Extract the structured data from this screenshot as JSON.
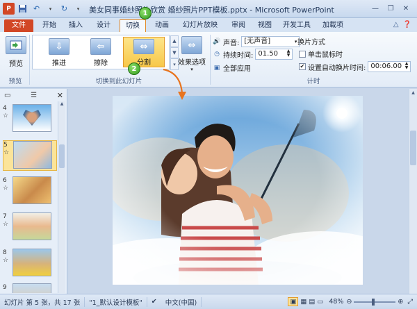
{
  "title": "美女同事婚纱照片欣赏 婚纱照片PPT模板.pptx - Microsoft PowerPoint",
  "tabs": {
    "file": "文件",
    "home": "开始",
    "insert": "插入",
    "design": "设计",
    "transitions": "切换",
    "animations": "动画",
    "slideshow": "幻灯片放映",
    "review": "审阅",
    "view": "视图",
    "developer": "开发工具",
    "addins": "加载项"
  },
  "ribbon": {
    "preview_label": "预览",
    "preview_group": "预览",
    "transitions": [
      {
        "label": "推进"
      },
      {
        "label": "擦除"
      },
      {
        "label": "分割"
      }
    ],
    "effect_options_label": "效果选项",
    "transitions_group": "切换到此幻灯片",
    "sound_label": "声音:",
    "sound_value": "[无声音]",
    "duration_label": "持续时间:",
    "duration_value": "01.50",
    "apply_all_label": "全部应用",
    "advance_label": "换片方式",
    "on_click_label": "单击鼠标时",
    "after_label": "设置自动换片时间:",
    "after_value": "00:06.00",
    "timing_group": "计时"
  },
  "slides": [
    {
      "num": "4",
      "star": "☆"
    },
    {
      "num": "5",
      "star": "☆"
    },
    {
      "num": "6",
      "star": "☆"
    },
    {
      "num": "7",
      "star": "☆"
    },
    {
      "num": "8",
      "star": "☆"
    },
    {
      "num": "9",
      "star": "☆"
    }
  ],
  "status": {
    "slide_info": "幻灯片 第 5 张，共 17 张",
    "theme": "\"1_默认设计模板\"",
    "language": "中文(中国)",
    "zoom": "48%"
  },
  "markers": [
    "1",
    "2"
  ],
  "colors": {
    "accent": "#d24726",
    "selected": "#f7c84a"
  }
}
